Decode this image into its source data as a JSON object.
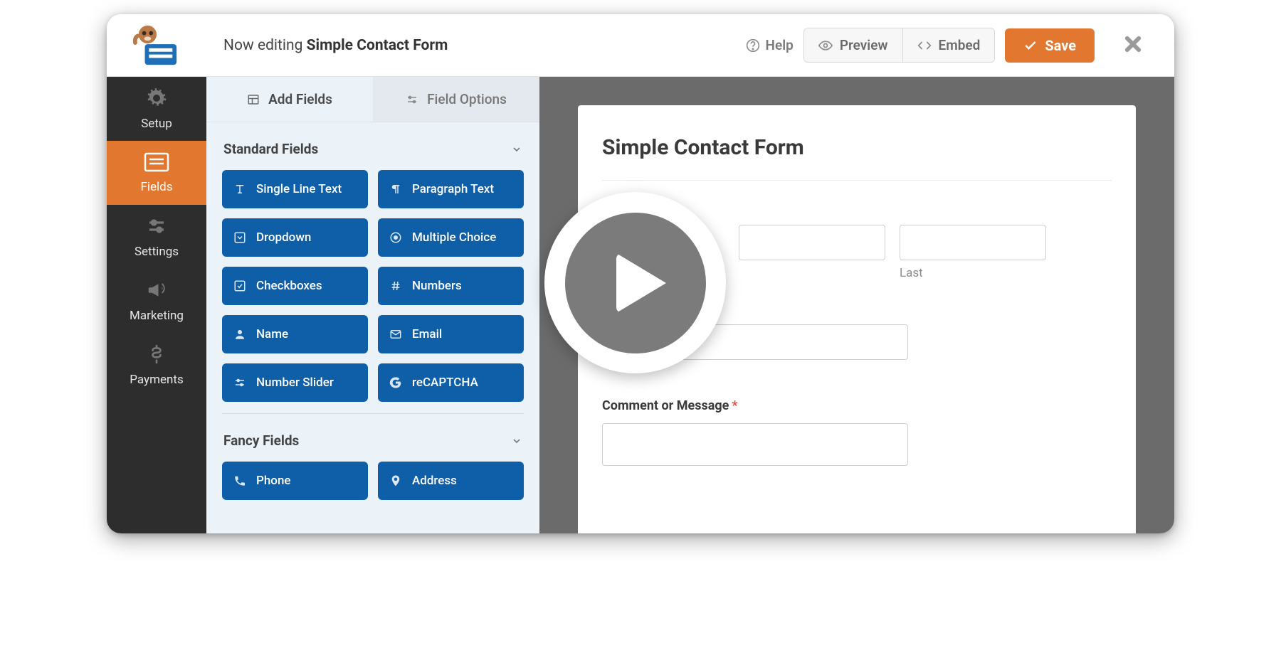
{
  "header": {
    "editing_prefix": "Now editing",
    "form_name": "Simple Contact Form",
    "help_label": "Help",
    "preview_label": "Preview",
    "embed_label": "Embed",
    "save_label": "Save"
  },
  "sidebar": {
    "items": [
      {
        "label": "Setup",
        "icon": "gear-icon"
      },
      {
        "label": "Fields",
        "icon": "form-icon",
        "active": true
      },
      {
        "label": "Settings",
        "icon": "sliders-icon"
      },
      {
        "label": "Marketing",
        "icon": "bullhorn-icon"
      },
      {
        "label": "Payments",
        "icon": "dollar-icon"
      }
    ]
  },
  "panel": {
    "tabs": {
      "add_fields": "Add Fields",
      "field_options": "Field Options"
    },
    "sections": {
      "standard_title": "Standard Fields",
      "fancy_title": "Fancy Fields"
    },
    "standard_fields": [
      {
        "label": "Single Line Text",
        "icon": "text-icon"
      },
      {
        "label": "Paragraph Text",
        "icon": "paragraph-icon"
      },
      {
        "label": "Dropdown",
        "icon": "caret-square-icon"
      },
      {
        "label": "Multiple Choice",
        "icon": "radio-icon"
      },
      {
        "label": "Checkboxes",
        "icon": "check-square-icon"
      },
      {
        "label": "Numbers",
        "icon": "hashtag-icon"
      },
      {
        "label": "Name",
        "icon": "user-icon"
      },
      {
        "label": "Email",
        "icon": "envelope-icon"
      },
      {
        "label": "Number Slider",
        "icon": "slider-icon"
      },
      {
        "label": "reCAPTCHA",
        "icon": "google-icon"
      }
    ],
    "fancy_fields": [
      {
        "label": "Phone",
        "icon": "phone-icon"
      },
      {
        "label": "Address",
        "icon": "map-pin-icon"
      }
    ]
  },
  "form": {
    "title": "Simple Contact Form",
    "name_sublabel_last": "Last",
    "comment_label": "Comment or Message"
  },
  "colors": {
    "accent_orange": "#e27730",
    "field_blue": "#0e5fa7",
    "panel_bg": "#ebf3f9",
    "canvas_bg": "#6b6b6b"
  }
}
